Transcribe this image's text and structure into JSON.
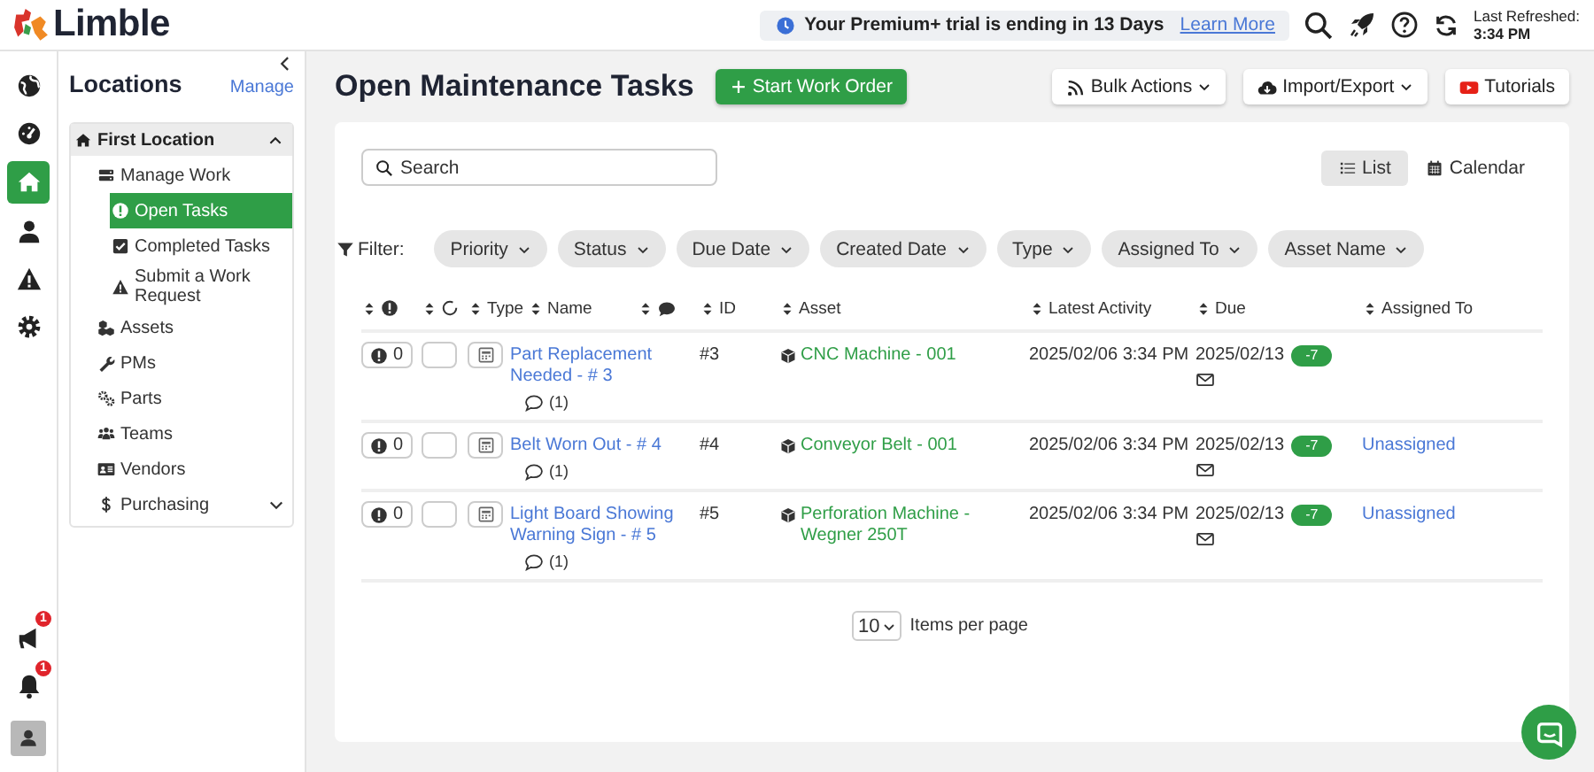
{
  "brand": {
    "name": "Limble"
  },
  "banner": {
    "text": "Your Premium+ trial is ending in 13 Days",
    "link": "Learn More"
  },
  "refresh": {
    "label": "Last Refreshed:",
    "time": "3:34 PM"
  },
  "rail": {
    "items": [
      {
        "kind": "globe",
        "selected": false
      },
      {
        "kind": "dashboard",
        "selected": false
      },
      {
        "kind": "home",
        "selected": true
      },
      {
        "kind": "user",
        "selected": false
      },
      {
        "kind": "warning",
        "selected": false
      },
      {
        "kind": "gear",
        "selected": false
      }
    ],
    "bottom": [
      {
        "kind": "megaphone",
        "badge": "1"
      },
      {
        "kind": "bell",
        "badge": "1"
      },
      {
        "kind": "profile"
      }
    ]
  },
  "locations": {
    "title": "Locations",
    "manage": "Manage",
    "location": {
      "name": "First Location",
      "expanded": true
    },
    "items": [
      {
        "kind": "work",
        "label": "Manage Work",
        "selected": false,
        "children": [
          {
            "kind": "open",
            "label": "Open Tasks",
            "selected": true
          },
          {
            "kind": "completed",
            "label": "Completed Tasks",
            "selected": false
          },
          {
            "kind": "request",
            "label": "Submit a Work Request",
            "selected": false
          }
        ]
      },
      {
        "kind": "assets",
        "label": "Assets",
        "selected": false
      },
      {
        "kind": "pms",
        "label": "PMs",
        "selected": false
      },
      {
        "kind": "parts",
        "label": "Parts",
        "selected": false
      },
      {
        "kind": "teams",
        "label": "Teams",
        "selected": false
      },
      {
        "kind": "vendors",
        "label": "Vendors",
        "selected": false
      },
      {
        "kind": "purchasing",
        "label": "Purchasing",
        "selected": false,
        "expanded": false
      }
    ]
  },
  "main": {
    "title": "Open Maintenance Tasks",
    "start_button": "Start Work Order",
    "actions": [
      {
        "kind": "bulk",
        "label": "Bulk Actions",
        "dropdown": true
      },
      {
        "kind": "import",
        "label": "Import/Export",
        "dropdown": true
      },
      {
        "kind": "tutorials",
        "label": "Tutorials",
        "dropdown": false
      }
    ],
    "search": {
      "placeholder": "Search"
    },
    "views": [
      {
        "kind": "list",
        "label": "List",
        "selected": true
      },
      {
        "kind": "calendar",
        "label": "Calendar",
        "selected": false
      }
    ],
    "filter_label": "Filter:",
    "filters": [
      "Priority",
      "Status",
      "Due Date",
      "Created Date",
      "Type",
      "Assigned To",
      "Asset Name"
    ],
    "table": {
      "columns": [
        {
          "kind": "priority"
        },
        {
          "kind": "status"
        },
        {
          "kind": "text",
          "label": "Type"
        },
        {
          "kind": "text",
          "label": "Name"
        },
        {
          "kind": "comments"
        },
        {
          "kind": "text",
          "label": "ID"
        },
        {
          "kind": "text",
          "label": "Asset"
        },
        {
          "kind": "text",
          "label": "Latest Activity"
        },
        {
          "kind": "text",
          "label": "Due"
        },
        {
          "kind": "text",
          "label": "Assigned To"
        }
      ],
      "rows": [
        {
          "priority": "0",
          "name": "Part Replacement Needed - # 3",
          "comments": "(1)",
          "id": "#3",
          "asset": "CNC Machine - 001",
          "latest_activity": "2025/02/06 3:34 PM",
          "due": "2025/02/13",
          "days": "-7"
        },
        {
          "priority": "0",
          "name": "Belt Worn Out - # 4",
          "comments": "(1)",
          "id": "#4",
          "asset": "Conveyor Belt - 001",
          "latest_activity": "2025/02/06 3:34 PM",
          "due": "2025/02/13",
          "days": "-7",
          "assigned_to": "Unassigned"
        },
        {
          "priority": "0",
          "name": "Light Board Showing Warning Sign - # 5",
          "comments": "(1)",
          "id": "#5",
          "asset": "Perforation Machine - Wegner 250T",
          "latest_activity": "2025/02/06 3:34 PM",
          "due": "2025/02/13",
          "days": "-7",
          "assigned_to": "Unassigned"
        }
      ]
    },
    "pagination": {
      "per_page": "10",
      "label": "Items per page"
    }
  }
}
